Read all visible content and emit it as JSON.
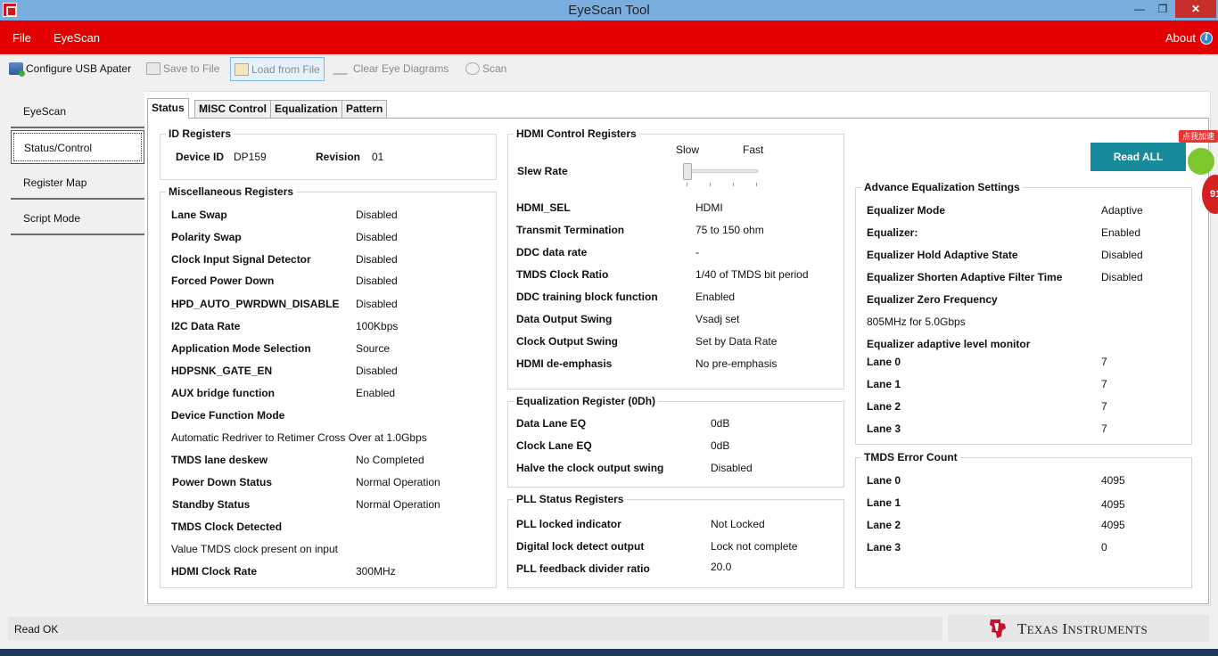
{
  "window": {
    "title": "EyeScan Tool"
  },
  "menubar": {
    "file": "File",
    "eyescan": "EyeScan",
    "about": "About"
  },
  "toolbar": {
    "configure": "Configure USB Apater",
    "save": "Save to File",
    "load": "Load from File",
    "clear": "Clear Eye Diagrams",
    "scan": "Scan"
  },
  "nav": [
    "EyeScan",
    "Status/Control",
    "Register Map",
    "Script Mode"
  ],
  "tabs": [
    "Status",
    "MISC Control",
    "Equalization",
    "Pattern"
  ],
  "id_registers": {
    "title": "ID Registers",
    "device_id_label": "Device ID",
    "device_id": "DP159",
    "revision_label": "Revision",
    "revision": "01"
  },
  "misc": {
    "title": "Miscellaneous Registers",
    "lane_swap": {
      "label": "Lane Swap",
      "value": "Disabled"
    },
    "polarity_swap": {
      "label": "Polarity Swap",
      "value": "Disabled"
    },
    "clock_input": {
      "label": "Clock Input Signal Detector",
      "value": "Disabled"
    },
    "forced_pd": {
      "label": "Forced Power Down",
      "value": "Disabled"
    },
    "hpd_auto": {
      "label": "HPD_AUTO_PWRDWN_DISABLE",
      "value": "Disabled"
    },
    "i2c_rate": {
      "label": "I2C Data Rate",
      "value": "100Kbps"
    },
    "app_mode": {
      "label": "Application Mode Selection",
      "value": "Source"
    },
    "hdpsnk": {
      "label": "HDPSNK_GATE_EN",
      "value": "Disabled"
    },
    "aux_bridge": {
      "label": "AUX bridge function",
      "value": "Enabled"
    },
    "device_func_label": "Device Function Mode",
    "device_func_value": "Automatic Redriver to Retimer Cross Over at 1.0Gbps",
    "tmds_deskew": {
      "label": "TMDS lane deskew",
      "value": "No Completed"
    },
    "pd_status": {
      "label": "Power Down Status",
      "value": "Normal Operation"
    },
    "standby": {
      "label": "Standby Status",
      "value": "Normal Operation"
    },
    "tmds_clock_label": "TMDS Clock Detected",
    "tmds_clock_value": "Value TMDS clock present on input",
    "hdmi_clock": {
      "label": "HDMI Clock Rate",
      "value": "300MHz"
    }
  },
  "hdmi_ctrl": {
    "title": "HDMI Control Registers",
    "slew_label": "Slew Rate",
    "slow": "Slow",
    "fast": "Fast",
    "slew_level": 0.0,
    "hdmi_sel": {
      "label": "HDMI_SEL",
      "value": "HDMI"
    },
    "term": {
      "label": "Transmit Termination",
      "value": "75 to 150 ohm"
    },
    "ddc_rate": {
      "label": "DDC data rate",
      "value": "-"
    },
    "tmds_ratio": {
      "label": "TMDS Clock Ratio",
      "value": "1/40 of TMDS bit period"
    },
    "ddc_training": {
      "label": "DDC training block function",
      "value": "Enabled"
    },
    "data_swing": {
      "label": "Data Output Swing",
      "value": "Vsadj set"
    },
    "clock_swing": {
      "label": "Clock Output Swing",
      "value": "Set by Data Rate"
    },
    "deemph": {
      "label": "HDMI de-emphasis",
      "value": "No pre-emphasis"
    }
  },
  "eq_reg": {
    "title": "Equalization Register (0Dh)",
    "data_eq": {
      "label": "Data Lane EQ",
      "value": "0dB"
    },
    "clock_eq": {
      "label": "Clock Lane EQ",
      "value": "0dB"
    },
    "halve": {
      "label": "Halve the clock output swing",
      "value": "Disabled"
    }
  },
  "pll": {
    "title": "PLL Status Registers",
    "locked": {
      "label": "PLL locked indicator",
      "value": "Not Locked"
    },
    "digital": {
      "label": "Digital lock detect output",
      "value": "Lock not complete"
    },
    "feedback": {
      "label": "PLL feedback divider ratio",
      "value": "20.0"
    }
  },
  "read_all": "Read ALL",
  "adv_eq": {
    "title": "Advance  Equalization Settings",
    "mode": {
      "label": "Equalizer Mode",
      "value": "Adaptive"
    },
    "eq": {
      "label": "Equalizer:",
      "value": "Enabled"
    },
    "hold": {
      "label": "Equalizer Hold Adaptive State",
      "value": "Disabled"
    },
    "shorten": {
      "label": "Equalizer Shorten Adaptive Filter Time",
      "value": "Disabled"
    },
    "zero_label": "Equalizer Zero Frequency",
    "zero_value": "805MHz for 5.0Gbps",
    "monitor_label": "Equalizer adaptive level monitor",
    "lanes": [
      {
        "label": "Lane 0",
        "value": "7"
      },
      {
        "label": "Lane 1",
        "value": "7"
      },
      {
        "label": "Lane 2",
        "value": "7"
      },
      {
        "label": "Lane 3",
        "value": "7"
      }
    ]
  },
  "tmds_err": {
    "title": "TMDS Error Count",
    "lanes": [
      {
        "label": "Lane 0",
        "value": "4095"
      },
      {
        "label": "Lane 1",
        "value": "4095"
      },
      {
        "label": "Lane 2",
        "value": "4095"
      },
      {
        "label": "Lane 3",
        "value": "0"
      }
    ]
  },
  "status": {
    "text": "Read OK"
  },
  "ti_logo": {
    "word1": "T",
    "word1b": "EXAS",
    "word2": "I",
    "word2b": "NSTRUMENTS"
  },
  "float_widget": {
    "tag": "点我加速",
    "number": "91"
  },
  "colors": {
    "menubar": "#e30000",
    "titlebar": "#7aaedf",
    "read_all": "#178a9b"
  }
}
